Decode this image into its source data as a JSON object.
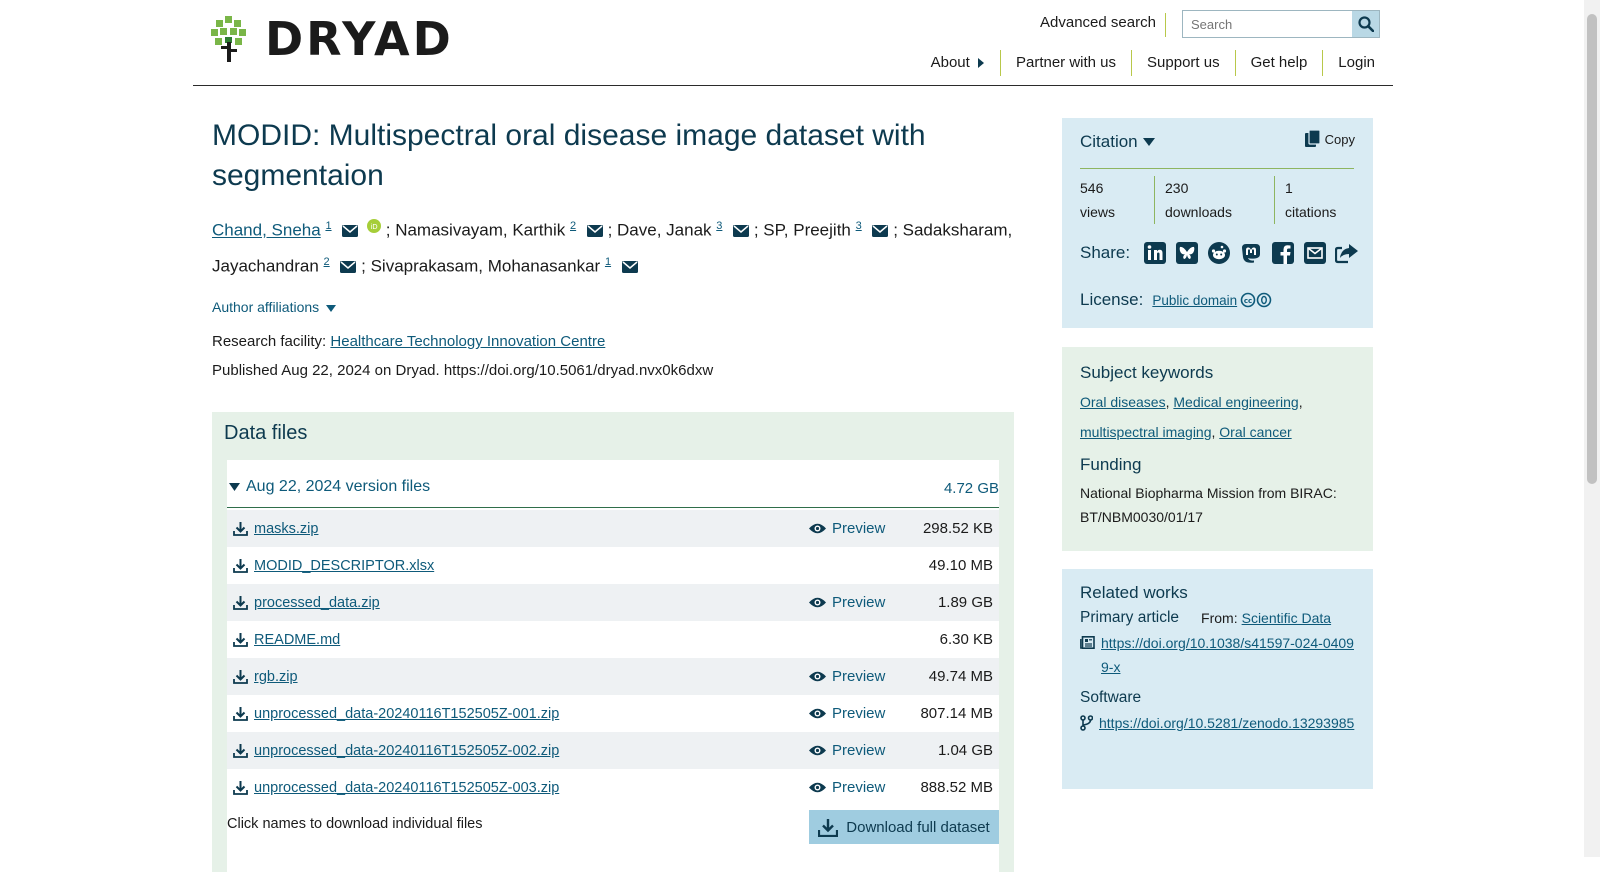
{
  "header": {
    "logo_text": "DRYAD",
    "advanced_search": "Advanced search",
    "search_placeholder": "Search",
    "nav": {
      "about": "About",
      "partner": "Partner with us",
      "support": "Support us",
      "help": "Get help",
      "login": "Login"
    }
  },
  "dataset": {
    "title": "MODID: Multispectral oral disease image dataset with segmentaion",
    "authors": [
      {
        "name": "Chand, Sneha",
        "aff": "1",
        "linked": true
      },
      {
        "name": "Namasivayam, Karthik",
        "aff": "2"
      },
      {
        "name": "Dave, Janak",
        "aff": "3"
      },
      {
        "name": "SP, Preejith",
        "aff": "3"
      },
      {
        "name": "Sadaksharam, Jayachandran",
        "aff": "2"
      },
      {
        "name": "Sivaprakasam, Mohanasankar",
        "aff": "1"
      }
    ],
    "author_affiliations": "Author affiliations",
    "research_facility_label": "Research facility:",
    "research_facility": "Healthcare Technology Innovation Centre",
    "published": "Published Aug 22, 2024 on Dryad. https://doi.org/10.5061/dryad.nvx0k6dxw"
  },
  "files": {
    "heading": "Data files",
    "version_label": "Aug 22, 2024 version files",
    "version_size": "4.72 GB",
    "preview_label": "Preview",
    "items": [
      {
        "name": "masks.zip",
        "size": "298.52 KB",
        "preview": true
      },
      {
        "name": "MODID_DESCRIPTOR.xlsx",
        "size": "49.10 MB",
        "preview": false
      },
      {
        "name": "processed_data.zip",
        "size": "1.89 GB",
        "preview": true
      },
      {
        "name": "README.md",
        "size": "6.30 KB",
        "preview": false
      },
      {
        "name": "rgb.zip",
        "size": "49.74 MB",
        "preview": true
      },
      {
        "name": "unprocessed_data-20240116T152505Z-001.zip",
        "size": "807.14 MB",
        "preview": true
      },
      {
        "name": "unprocessed_data-20240116T152505Z-002.zip",
        "size": "1.04 GB",
        "preview": true
      },
      {
        "name": "unprocessed_data-20240116T152505Z-003.zip",
        "size": "888.52 MB",
        "preview": true
      }
    ],
    "click_note": "Click names to download individual files",
    "download_full": "Download full dataset"
  },
  "sidebar": {
    "citation_label": "Citation",
    "copy_label": "Copy",
    "stats": [
      {
        "value": "546",
        "label": "views"
      },
      {
        "value": "230",
        "label": "downloads"
      },
      {
        "value": "1",
        "label": "citations"
      }
    ],
    "share_label": "Share:",
    "share_icons": [
      "linkedin-icon",
      "bluesky-icon",
      "reddit-icon",
      "mastodon-icon",
      "facebook-icon",
      "email-icon",
      "share-icon"
    ],
    "license_label": "License:",
    "license_value": "Public domain",
    "keywords_heading": "Subject keywords",
    "keywords": [
      "Oral diseases",
      "Medical engineering",
      "multispectral imaging",
      "Oral cancer"
    ],
    "funding_heading": "Funding",
    "funding_text": "National Biopharma Mission from BIRAC: BT/NBM0030/01/17",
    "related_heading": "Related works",
    "primary_article_label": "Primary article",
    "from_label": "From:",
    "from_value": "Scientific Data",
    "primary_article_link": "https://doi.org/10.1038/s41597-024-04099-x",
    "software_label": "Software",
    "software_link": "https://doi.org/10.5281/zenodo.13293985"
  },
  "colors": {
    "link": "#0e5a7a",
    "heading": "#0d3a4f",
    "sidebar_blue": "#d9ebf3",
    "sidebar_green": "#e6f1e8"
  }
}
